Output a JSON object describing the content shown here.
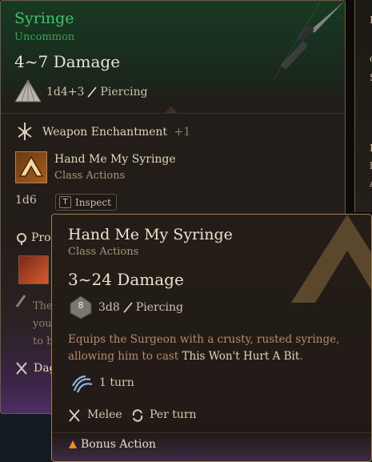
{
  "item": {
    "name": "Syringe",
    "rarity": "Uncommon",
    "damage": "4~7 Damage",
    "dice": "1d4+3",
    "damage_type": "Piercing",
    "enchant_label": "Weapon Enchantment",
    "enchant_value": "+1",
    "action_name": "Hand Me My Syringe",
    "action_class": "Class Actions",
    "action_dice": "1d6",
    "inspect_key": "T",
    "inspect_label": "Inspect",
    "prof_label": "Prof",
    "faded_text_1": "The",
    "faded_text_2": "you",
    "faded_text_3": "to h",
    "dagger_label": "Dag"
  },
  "tooltip": {
    "title": "Hand Me My Syringe",
    "subtitle": "Class Actions",
    "damage": "3~24 Damage",
    "die_number": "8",
    "dice": "3d8",
    "damage_type": "Piercing",
    "description_prefix": "Equips the Surgeon with a crusty, rusted syringe, allowing him to cast ",
    "description_highlight": "This Won't Hurt A Bit",
    "description_suffix": ".",
    "duration": "1 turn",
    "tag_1": "Melee",
    "tag_2": "Per turn",
    "cost": "Bonus Action"
  },
  "side_card": {
    "glyphs": [
      "E",
      "o",
      "S",
      "I",
      "h",
      "A"
    ]
  },
  "colors": {
    "rarity_green": "#3fc569",
    "accent_gold": "#e3d6b9",
    "bonus_action": "#f08a24"
  }
}
